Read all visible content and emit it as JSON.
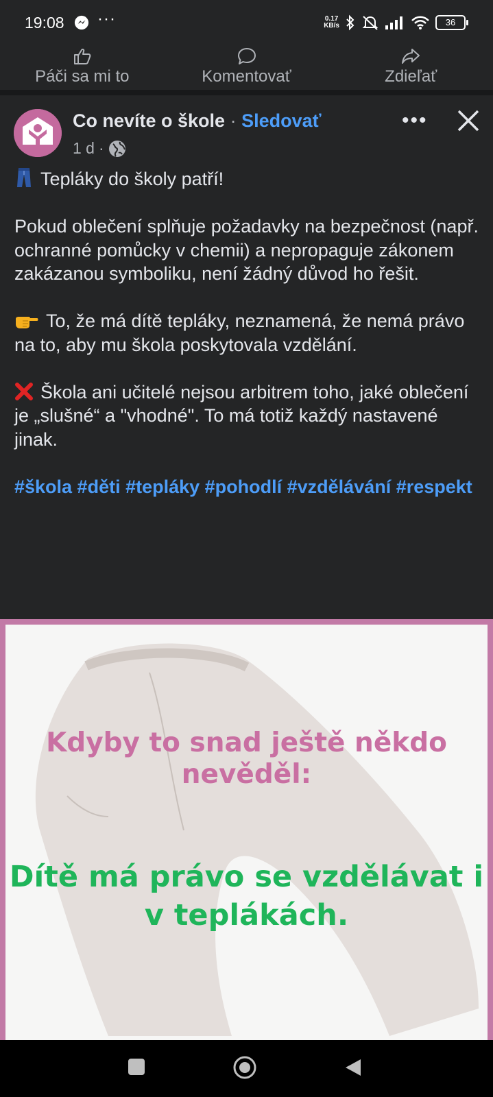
{
  "status_bar": {
    "time": "19:08",
    "net_speed_value": "0.17",
    "net_speed_unit": "KB/s",
    "battery": "36",
    "icons": [
      "messenger-icon",
      "more-dots-icon",
      "bluetooth-icon",
      "mute-icon",
      "signal-icon",
      "wifi-icon",
      "battery-icon"
    ]
  },
  "actions": {
    "like": "Páči sa mi to",
    "comment": "Komentovať",
    "share": "Zdieľať"
  },
  "post": {
    "page_name": "Co nevíte o škole",
    "separator": "·",
    "follow": "Sledovať",
    "time": "1 d",
    "meta_separator": "·",
    "line1": "Tepláky do školy patří!",
    "para1": "Pokud oblečení splňuje požadavky na bezpečnost (např. ochranné pomůcky v chemii) a nepropaguje zákonem zakázanou symboliku, není žádný důvod ho řešit.",
    "para2": "To, že má dítě tepláky, neznamená, že nemá právo na to, aby mu škola poskytovala vzdělání.",
    "para3": "Škola ani učitelé nejsou arbitrem toho, jaké oblečení je „slušné“ a \"vhodné\". To má totiž každý nastavené jinak.",
    "hashtags": "#škola #děti #tepláky #pohodlí #vzdělávání #respekt"
  },
  "image": {
    "line1": "Kdyby to snad ještě někdo nevěděl:",
    "line2": "Dítě má právo se vzdělávat i v teplákách."
  },
  "colors": {
    "background": "#242526",
    "link": "#4d9df8",
    "image_pink": "#c96fa2",
    "image_green": "#1fb55a"
  }
}
